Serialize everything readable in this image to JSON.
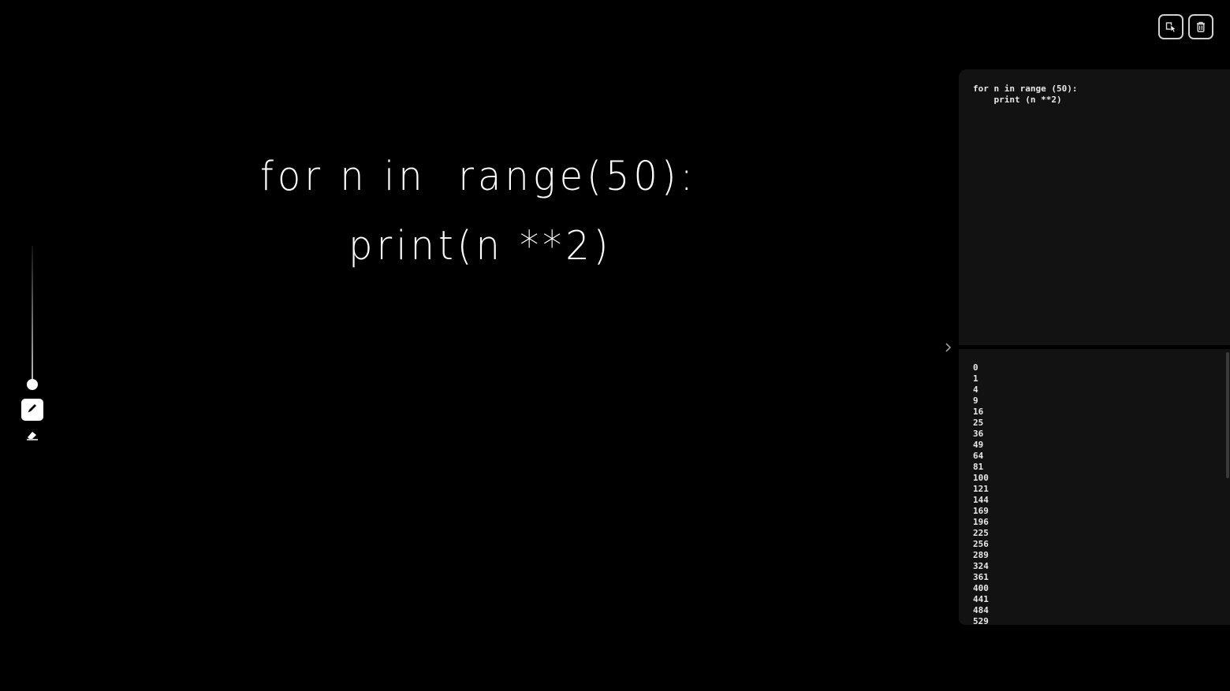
{
  "toolbar": {
    "run_icon": "cursor-icon",
    "delete_icon": "trash-icon"
  },
  "canvas": {
    "line_1": "for n in  range(50):",
    "line_2": "print(n **2)"
  },
  "tools": {
    "size_slider_level": 1.0,
    "active_tool": "pen",
    "pen_icon": "pen-icon",
    "eraser_icon": "eraser-icon"
  },
  "code_panel": {
    "code": "for n in range (50):\n    print (n **2)"
  },
  "output_panel": {
    "lines": [
      "0",
      "1",
      "4",
      "9",
      "16",
      "25",
      "36",
      "49",
      "64",
      "81",
      "100",
      "121",
      "144",
      "169",
      "196",
      "225",
      "256",
      "289",
      "324",
      "361",
      "400",
      "441",
      "484",
      "529"
    ]
  },
  "colors": {
    "background": "#000000",
    "panel": "#121212",
    "text": "#e8e8e8"
  }
}
